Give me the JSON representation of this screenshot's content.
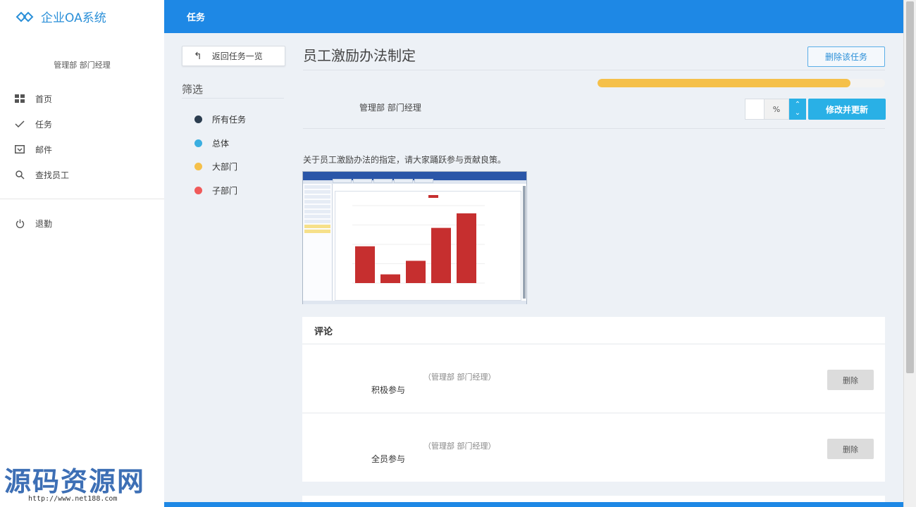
{
  "app": {
    "title": "企业OA系统"
  },
  "user": {
    "role": "管理部 部门经理"
  },
  "sidebar": {
    "items": [
      {
        "label": "首页",
        "icon": "dashboard-icon"
      },
      {
        "label": "任务",
        "icon": "check-icon"
      },
      {
        "label": "邮件",
        "icon": "inbox-icon"
      },
      {
        "label": "查找员工",
        "icon": "search-icon"
      }
    ],
    "logout": {
      "label": "退勤",
      "icon": "power-icon"
    }
  },
  "header": {
    "title": "任务"
  },
  "filter": {
    "back_label": "返回任务一览",
    "title": "筛选",
    "items": [
      {
        "label": "所有任务",
        "color": "#2c3e50"
      },
      {
        "label": "总体",
        "color": "#3aaee0"
      },
      {
        "label": "大部门",
        "color": "#f5c04a"
      },
      {
        "label": "子部门",
        "color": "#f05a5a"
      }
    ]
  },
  "task": {
    "title": "员工激励办法制定",
    "delete_label": "删除该任务",
    "progress": 0.88,
    "assignee": "管理部 部门经理",
    "percent_unit": "%",
    "update_label": "修改并更新",
    "description": "关于员工激励办法的指定，请大家踊跃参与贡献良策。"
  },
  "attachment_chart": {
    "values": [
      38,
      9,
      23,
      57,
      72
    ]
  },
  "comments": {
    "title": "评论",
    "items": [
      {
        "author": "（管理部 部门经理）",
        "text": "积极参与",
        "delete_label": "删除"
      },
      {
        "author": "（管理部 部门经理）",
        "text": "全员参与",
        "delete_label": "删除"
      }
    ]
  },
  "watermark": {
    "text": "源码资源网",
    "url": "http://www.net188.com"
  }
}
